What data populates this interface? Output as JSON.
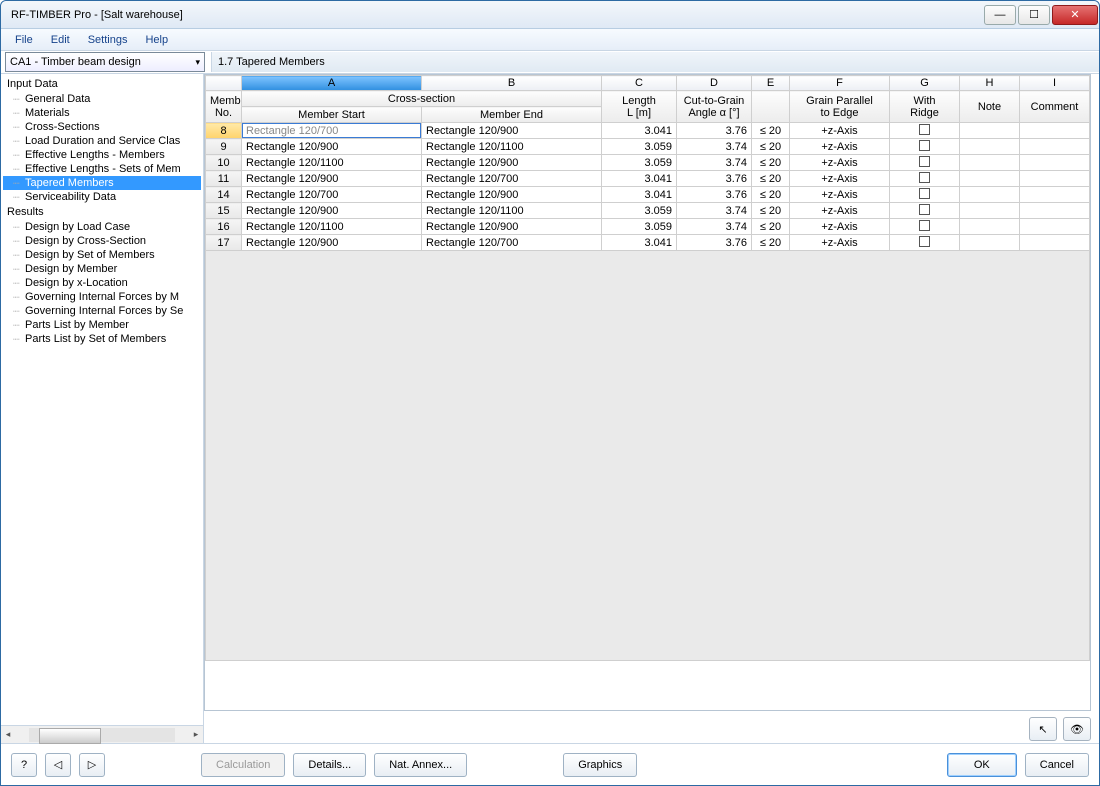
{
  "window": {
    "title": "RF-TIMBER Pro - [Salt warehouse]"
  },
  "menubar": [
    "File",
    "Edit",
    "Settings",
    "Help"
  ],
  "combo": {
    "value": "CA1 - Timber beam design"
  },
  "section_title": "1.7 Tapered Members",
  "tree": {
    "input_header": "Input Data",
    "input_items": [
      "General Data",
      "Materials",
      "Cross-Sections",
      "Load Duration and Service Clas",
      "Effective Lengths - Members",
      "Effective Lengths - Sets of Mem",
      "Tapered Members",
      "Serviceability Data"
    ],
    "results_header": "Results",
    "results_items": [
      "Design by Load Case",
      "Design by Cross-Section",
      "Design by Set of Members",
      "Design by Member",
      "Design by x-Location",
      "Governing Internal Forces by M",
      "Governing Internal Forces by Se",
      "Parts List by Member",
      "Parts List by Set of Members"
    ],
    "selected": "Tapered Members"
  },
  "grid": {
    "letters": [
      "A",
      "B",
      "C",
      "D",
      "E",
      "F",
      "G",
      "H",
      "I"
    ],
    "group_row": {
      "member_no": [
        "Member",
        "No."
      ],
      "cross_section": "Cross-section",
      "length": [
        "Length",
        "L [m]"
      ],
      "angle": [
        "Cut-to-Grain",
        "Angle α [°]"
      ],
      "e": "",
      "grain": [
        "Grain Parallel",
        "to Edge"
      ],
      "ridge": [
        "With",
        "Ridge"
      ],
      "note": "Note",
      "comment": "Comment"
    },
    "sub_row": {
      "a": "Member Start",
      "b": "Member End"
    },
    "rows": [
      {
        "no": "8",
        "a": "Rectangle 120/700",
        "b": "Rectangle 120/900",
        "c": "3.041",
        "d": "3.76",
        "e": "≤ 20",
        "f": "+z-Axis"
      },
      {
        "no": "9",
        "a": "Rectangle 120/900",
        "b": "Rectangle 120/1100",
        "c": "3.059",
        "d": "3.74",
        "e": "≤ 20",
        "f": "+z-Axis"
      },
      {
        "no": "10",
        "a": "Rectangle 120/1100",
        "b": "Rectangle 120/900",
        "c": "3.059",
        "d": "3.74",
        "e": "≤ 20",
        "f": "+z-Axis"
      },
      {
        "no": "11",
        "a": "Rectangle 120/900",
        "b": "Rectangle 120/700",
        "c": "3.041",
        "d": "3.76",
        "e": "≤ 20",
        "f": "+z-Axis"
      },
      {
        "no": "14",
        "a": "Rectangle 120/700",
        "b": "Rectangle 120/900",
        "c": "3.041",
        "d": "3.76",
        "e": "≤ 20",
        "f": "+z-Axis"
      },
      {
        "no": "15",
        "a": "Rectangle 120/900",
        "b": "Rectangle 120/1100",
        "c": "3.059",
        "d": "3.74",
        "e": "≤ 20",
        "f": "+z-Axis"
      },
      {
        "no": "16",
        "a": "Rectangle 120/1100",
        "b": "Rectangle 120/900",
        "c": "3.059",
        "d": "3.74",
        "e": "≤ 20",
        "f": "+z-Axis"
      },
      {
        "no": "17",
        "a": "Rectangle 120/900",
        "b": "Rectangle 120/700",
        "c": "3.041",
        "d": "3.76",
        "e": "≤ 20",
        "f": "+z-Axis"
      }
    ]
  },
  "footer": {
    "calculation": "Calculation",
    "details": "Details...",
    "nat_annex": "Nat. Annex...",
    "graphics": "Graphics",
    "ok": "OK",
    "cancel": "Cancel"
  },
  "icons": {
    "help": "?",
    "prev": "◁",
    "next": "▷",
    "pick": "↖",
    "view": "👁",
    "min": "—",
    "max": "☐",
    "close": "✕",
    "dd": "▾"
  }
}
